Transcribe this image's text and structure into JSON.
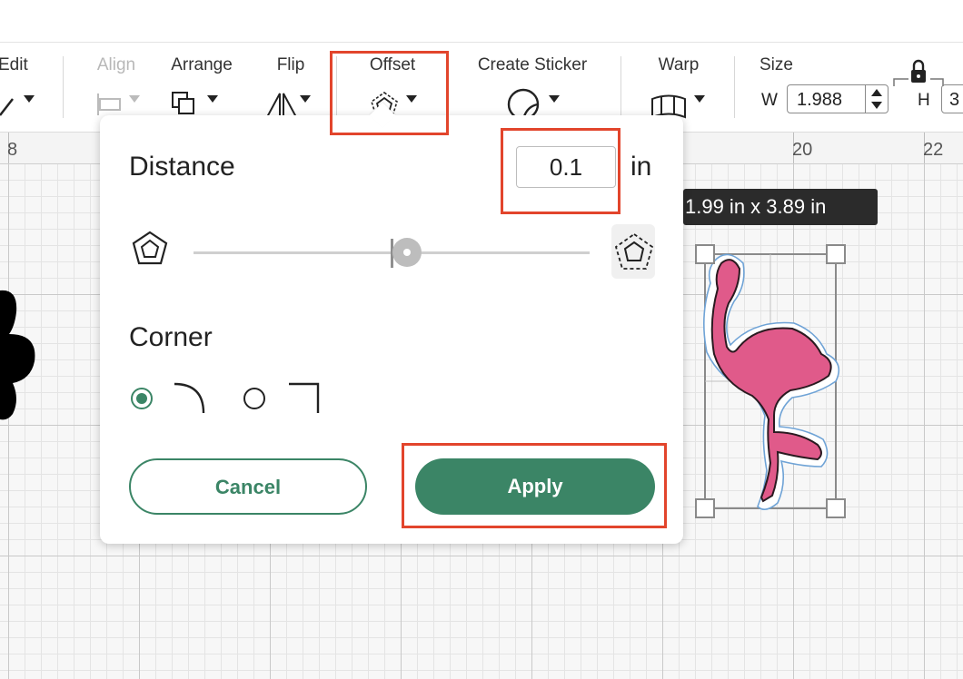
{
  "toolbar": {
    "edit_label": "Edit",
    "align_label": "Align",
    "arrange_label": "Arrange",
    "flip_label": "Flip",
    "offset_label": "Offset",
    "create_sticker_label": "Create Sticker",
    "warp_label": "Warp",
    "size_label": "Size",
    "width_prefix": "W",
    "width_value": "1.988",
    "height_prefix": "H",
    "height_value": "3"
  },
  "ruler": {
    "labels": [
      "8",
      "20",
      "22"
    ]
  },
  "offset_popup": {
    "distance_label": "Distance",
    "distance_value": "0.1",
    "distance_unit": "in",
    "slider_level_fraction": 0.54,
    "corner_label": "Corner",
    "corner_options": [
      {
        "name": "rounded",
        "selected": true
      },
      {
        "name": "square",
        "selected": false
      }
    ],
    "cancel_label": "Cancel",
    "apply_label": "Apply"
  },
  "selection": {
    "dimensions": "1.99  in x 3.89  in"
  },
  "colors": {
    "accent": "#3b8566",
    "highlight": "#e2452c",
    "flamingo": "#e05a8a",
    "offset_outline": "#6fa3d6"
  }
}
